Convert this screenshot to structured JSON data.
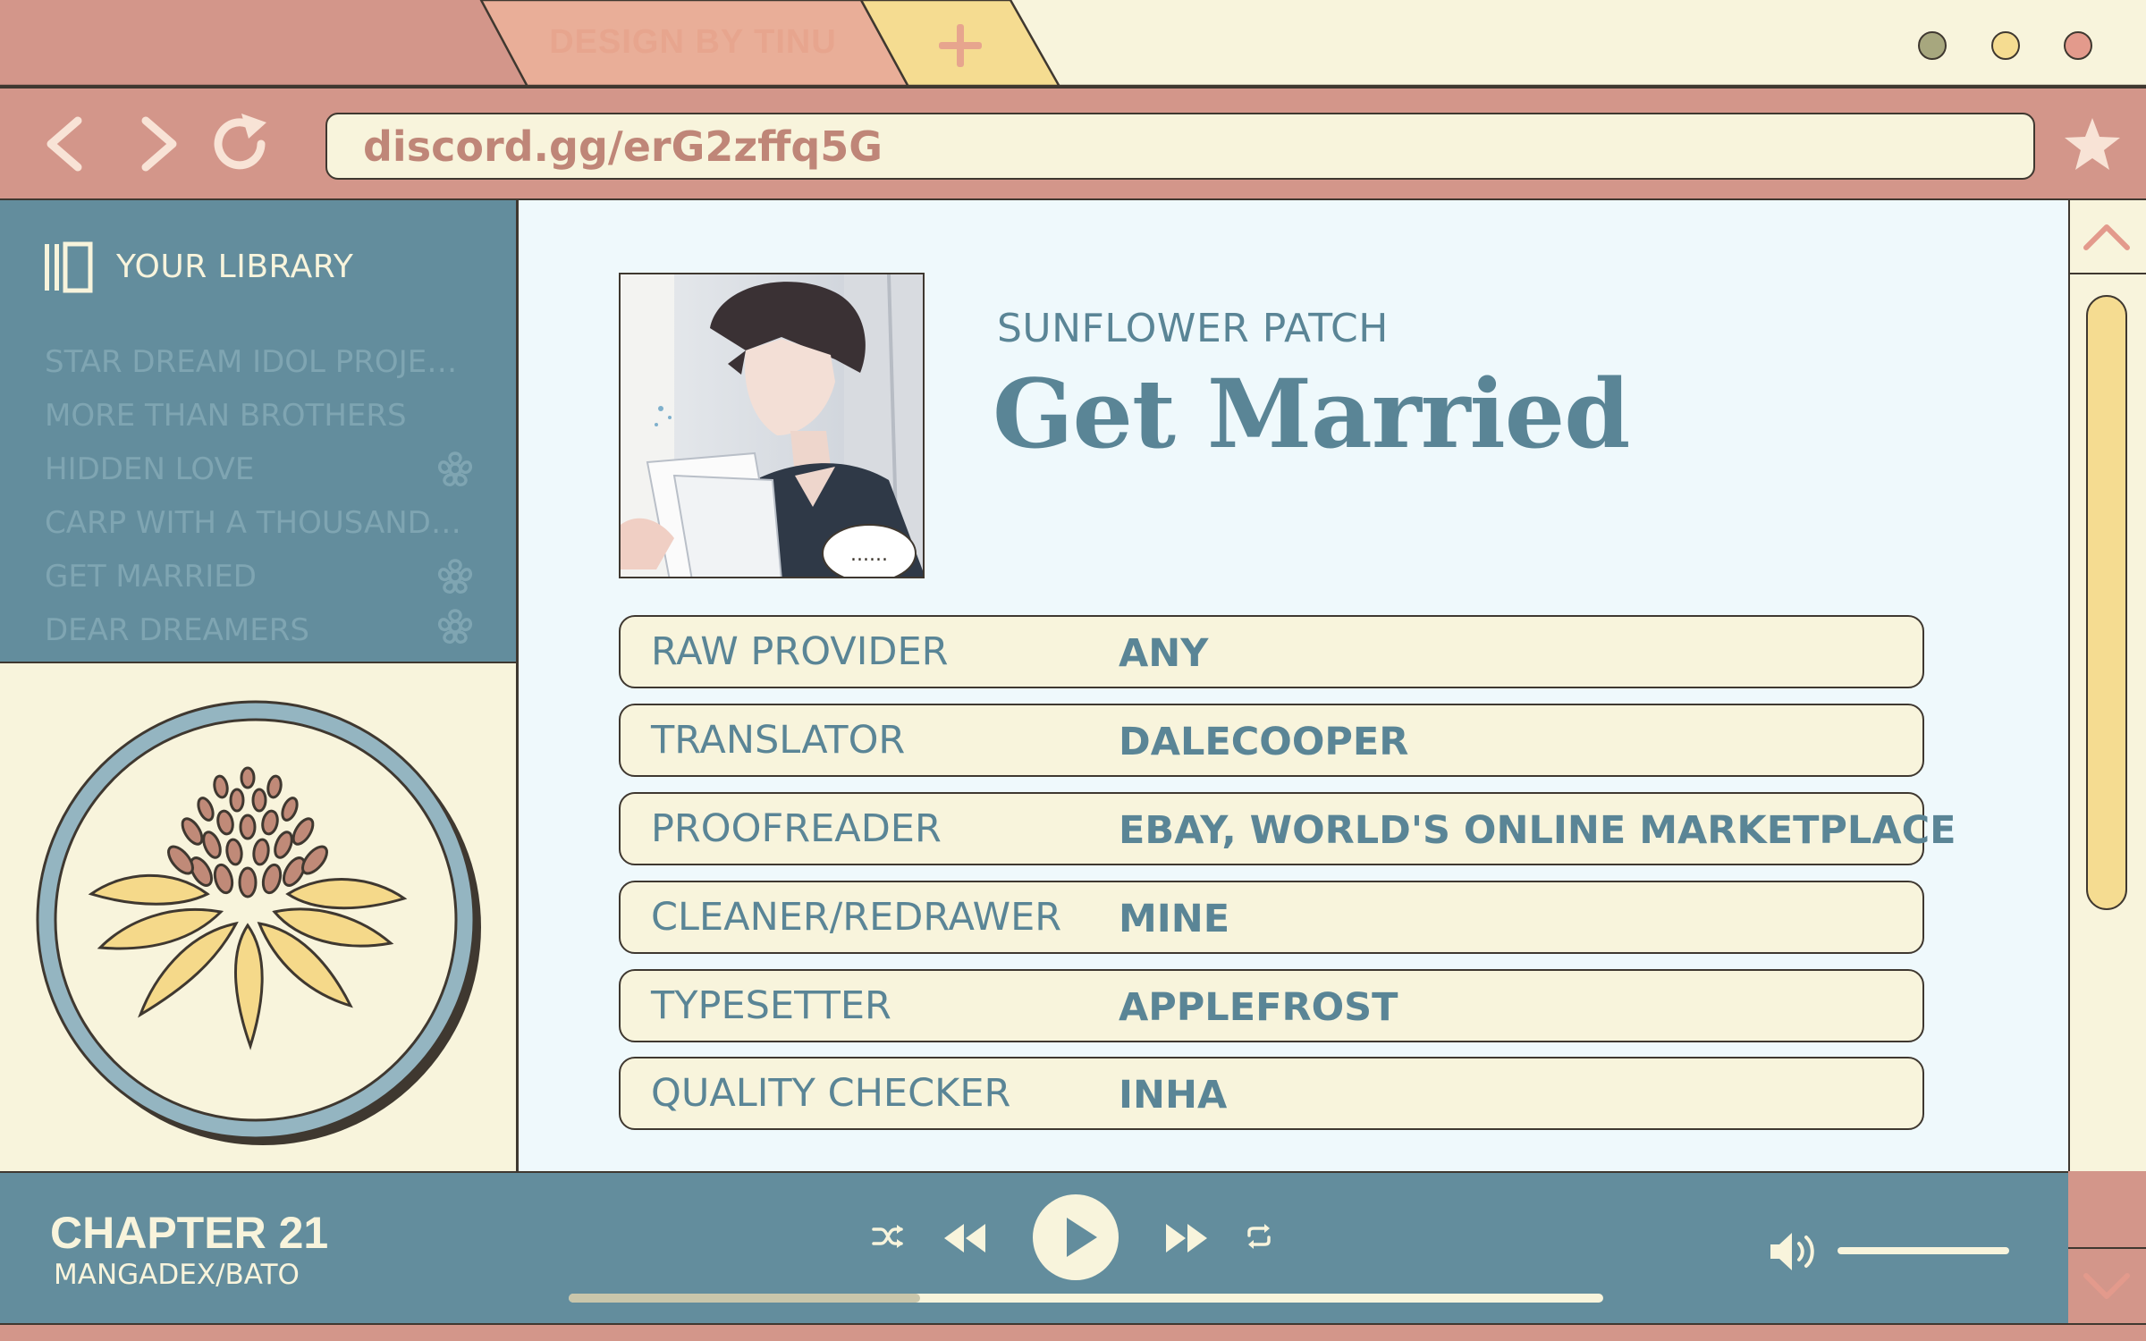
{
  "browser": {
    "tab_label": "DESIGN BY TINU",
    "url": "discord.gg/erG2zffq5G"
  },
  "sidebar": {
    "title": "YOUR LIBRARY",
    "items": [
      {
        "label": "STAR DREAM IDOL PROJECT",
        "icon": ""
      },
      {
        "label": "MORE THAN BROTHERS",
        "icon": ""
      },
      {
        "label": "HIDDEN LOVE",
        "icon": "flower-icon"
      },
      {
        "label": "CARP WITH A THOUSAND E...",
        "icon": ""
      },
      {
        "label": "GET MARRIED",
        "icon": "flower-icon"
      },
      {
        "label": "DEAR DREAMERS",
        "icon": "flower-icon"
      }
    ]
  },
  "main": {
    "group": "SUNFLOWER PATCH",
    "title": "Get Married",
    "credits": [
      {
        "role": "RAW PROVIDER",
        "name": "ANY"
      },
      {
        "role": "TRANSLATOR",
        "name": "DALECOOPER"
      },
      {
        "role": "PROOFREADER",
        "name": "EBAY, WORLD'S ONLINE MARKETPLACE"
      },
      {
        "role": "CLEANER/REDRAWER",
        "name": "MINE"
      },
      {
        "role": "TYPESETTER",
        "name": "APPLEFROST"
      },
      {
        "role": "QUALITY CHECKER",
        "name": "INHA"
      }
    ],
    "cover_speech": "......"
  },
  "player": {
    "chapter": "CHAPTER 21",
    "source": "MANGADEX/BATO",
    "progress": 0.34,
    "volume": 1.0
  },
  "colors": {
    "accent_blue": "#638d9d",
    "cream": "#f8f4dc",
    "rose": "#d3968a",
    "yellow": "#f5dc91",
    "dot_green": "#a7a77e",
    "dot_yellow": "#f5dc91",
    "dot_red": "#e39a8c"
  }
}
